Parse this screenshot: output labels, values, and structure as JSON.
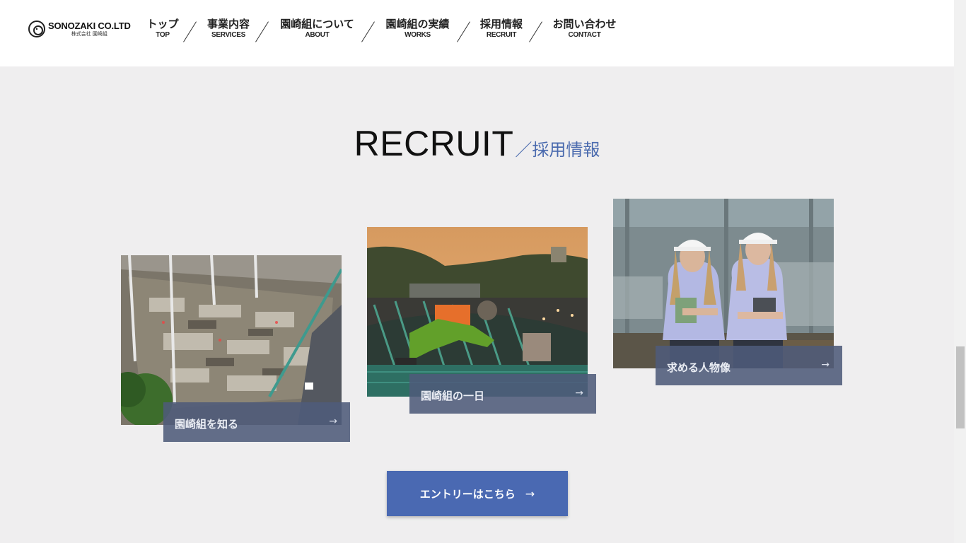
{
  "header": {
    "logo": {
      "name": "SONOZAKI CO.LTD",
      "sub": "株式会社 園崎組"
    },
    "nav": [
      {
        "jp": "トップ",
        "en": "TOP"
      },
      {
        "jp": "事業内容",
        "en": "SERVICES"
      },
      {
        "jp": "園崎組について",
        "en": "ABOUT"
      },
      {
        "jp": "園崎組の実績",
        "en": "WORKS"
      },
      {
        "jp": "採用情報",
        "en": "RECRUIT"
      },
      {
        "jp": "お問い合わせ",
        "en": "CONTACT"
      }
    ]
  },
  "section": {
    "title_en": "RECRUIT",
    "title_jp": "／採用情報"
  },
  "cards": [
    {
      "label": "園崎組を知る",
      "photo": "construction-site-aerial",
      "arrow": "→"
    },
    {
      "label": "園崎組の一日",
      "photo": "worker-at-sunset",
      "arrow": "→"
    },
    {
      "label": "求める人物像",
      "photo": "two-women-hard-hats",
      "arrow": "→"
    }
  ],
  "entry_button": {
    "label": "エントリーはこちら",
    "arrow": "→"
  },
  "colors": {
    "accent": "#4a69b2",
    "title_jp": "#4a6aae",
    "card_label_bg": "#4e5b7a",
    "page_bg": "#efeeef"
  }
}
